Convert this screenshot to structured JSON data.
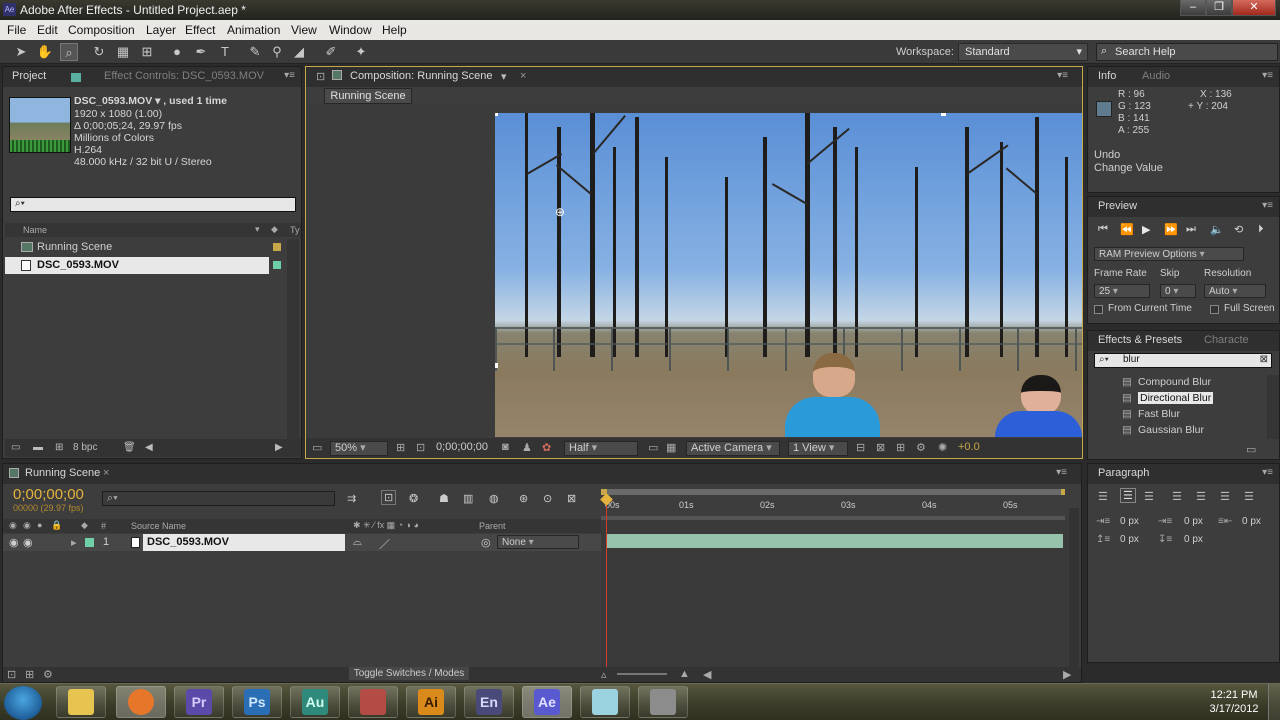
{
  "window": {
    "title": "Adobe After Effects - Untitled Project.aep *",
    "app_icon": "Ae"
  },
  "menu": [
    "File",
    "Edit",
    "Composition",
    "Layer",
    "Effect",
    "Animation",
    "View",
    "Window",
    "Help"
  ],
  "toolbar": {
    "workspace_label": "Workspace:",
    "workspace_value": "Standard",
    "search_help_placeholder": "Search Help"
  },
  "project": {
    "tab_project": "Project",
    "tab_effect_controls": "Effect Controls: DSC_0593.MOV",
    "file_name": "DSC_0593.MOV ▾ , used 1 time",
    "file_dims": "1920 x 1080 (1.00)",
    "file_duration": "Δ 0;00;05;24, 29.97 fps",
    "file_colors": "Millions of Colors",
    "file_codec": "H.264",
    "file_audio": "48.000 kHz / 32 bit U / Stereo",
    "search_placeholder": "⌕▾",
    "col_name": "Name",
    "col_type": "Ty",
    "items": [
      {
        "label": "Running Scene",
        "selected": false
      },
      {
        "label": "DSC_0593.MOV",
        "selected": true
      }
    ],
    "bpc": "8 bpc"
  },
  "composition": {
    "tab": "Composition: Running Scene",
    "subtab": "Running Scene",
    "zoom": "50%",
    "timecode": "0;00;00;00",
    "resolution": "Half",
    "camera": "Active Camera",
    "views": "1 View",
    "exposure": "+0.0"
  },
  "info": {
    "tab_info": "Info",
    "tab_audio": "Audio",
    "r": "R : 96",
    "g": "G : 123",
    "b": "B : 141",
    "a": "A : 255",
    "x": "X : 136",
    "y": "+ Y : 204",
    "undo_label": "Undo",
    "undo_value": "Change Value"
  },
  "preview": {
    "tab": "Preview",
    "ram_options": "RAM Preview Options",
    "frame_rate_label": "Frame Rate",
    "skip_label": "Skip",
    "resolution_label": "Resolution",
    "frame_rate_value": "25",
    "skip_value": "0",
    "resolution_value": "Auto",
    "from_current_time": "From Current Time",
    "full_screen": "Full Screen"
  },
  "effects": {
    "tab": "Effects & Presets",
    "tab2": "Characte",
    "search_value": "blur",
    "items": [
      "Compound Blur",
      "Directional Blur",
      "Fast Blur",
      "Gaussian Blur"
    ],
    "selected_index": 1
  },
  "paragraph": {
    "tab": "Paragraph",
    "indent_1": "0 px",
    "indent_2": "0 px",
    "indent_3": "0 px",
    "space_1": "0 px",
    "space_2": "0 px"
  },
  "timeline": {
    "tab": "Running Scene",
    "timecode": "0;00;00;00",
    "fps_line": "00000 (29.97 fps)",
    "col_source_name": "Source Name",
    "col_parent": "Parent",
    "col_num": "#",
    "layer_number": "1",
    "layer_name": "DSC_0593.MOV",
    "parent_value": "None",
    "ruler_labels": [
      "00s",
      "01s",
      "02s",
      "03s",
      "04s",
      "05s"
    ],
    "toggle_label": "Toggle Switches / Modes"
  },
  "taskbar": {
    "apps": [
      {
        "label": "",
        "icon": "folder-icon",
        "color": "#e7c34f"
      },
      {
        "label": "",
        "icon": "firefox-icon",
        "color": "#e6762a"
      },
      {
        "label": "Pr",
        "icon": "premiere-icon",
        "color": "#5b4aa8"
      },
      {
        "label": "Ps",
        "icon": "photoshop-icon",
        "color": "#2a6fb6"
      },
      {
        "label": "Au",
        "icon": "audition-icon",
        "color": "#2f8a7c"
      },
      {
        "label": "",
        "icon": "document-icon",
        "color": "#b24c45"
      },
      {
        "label": "Ai",
        "icon": "illustrator-icon",
        "color": "#d98a1a"
      },
      {
        "label": "En",
        "icon": "encore-icon",
        "color": "#4a4a7a"
      },
      {
        "label": "Ae",
        "icon": "after-effects-icon",
        "color": "#5a5ad0"
      },
      {
        "label": "",
        "icon": "notes-icon",
        "color": "#9ad2e0"
      },
      {
        "label": "",
        "icon": "usb-icon",
        "color": "#8c8c8c"
      }
    ],
    "clock_time": "12:21 PM",
    "clock_date": "3/17/2012"
  }
}
